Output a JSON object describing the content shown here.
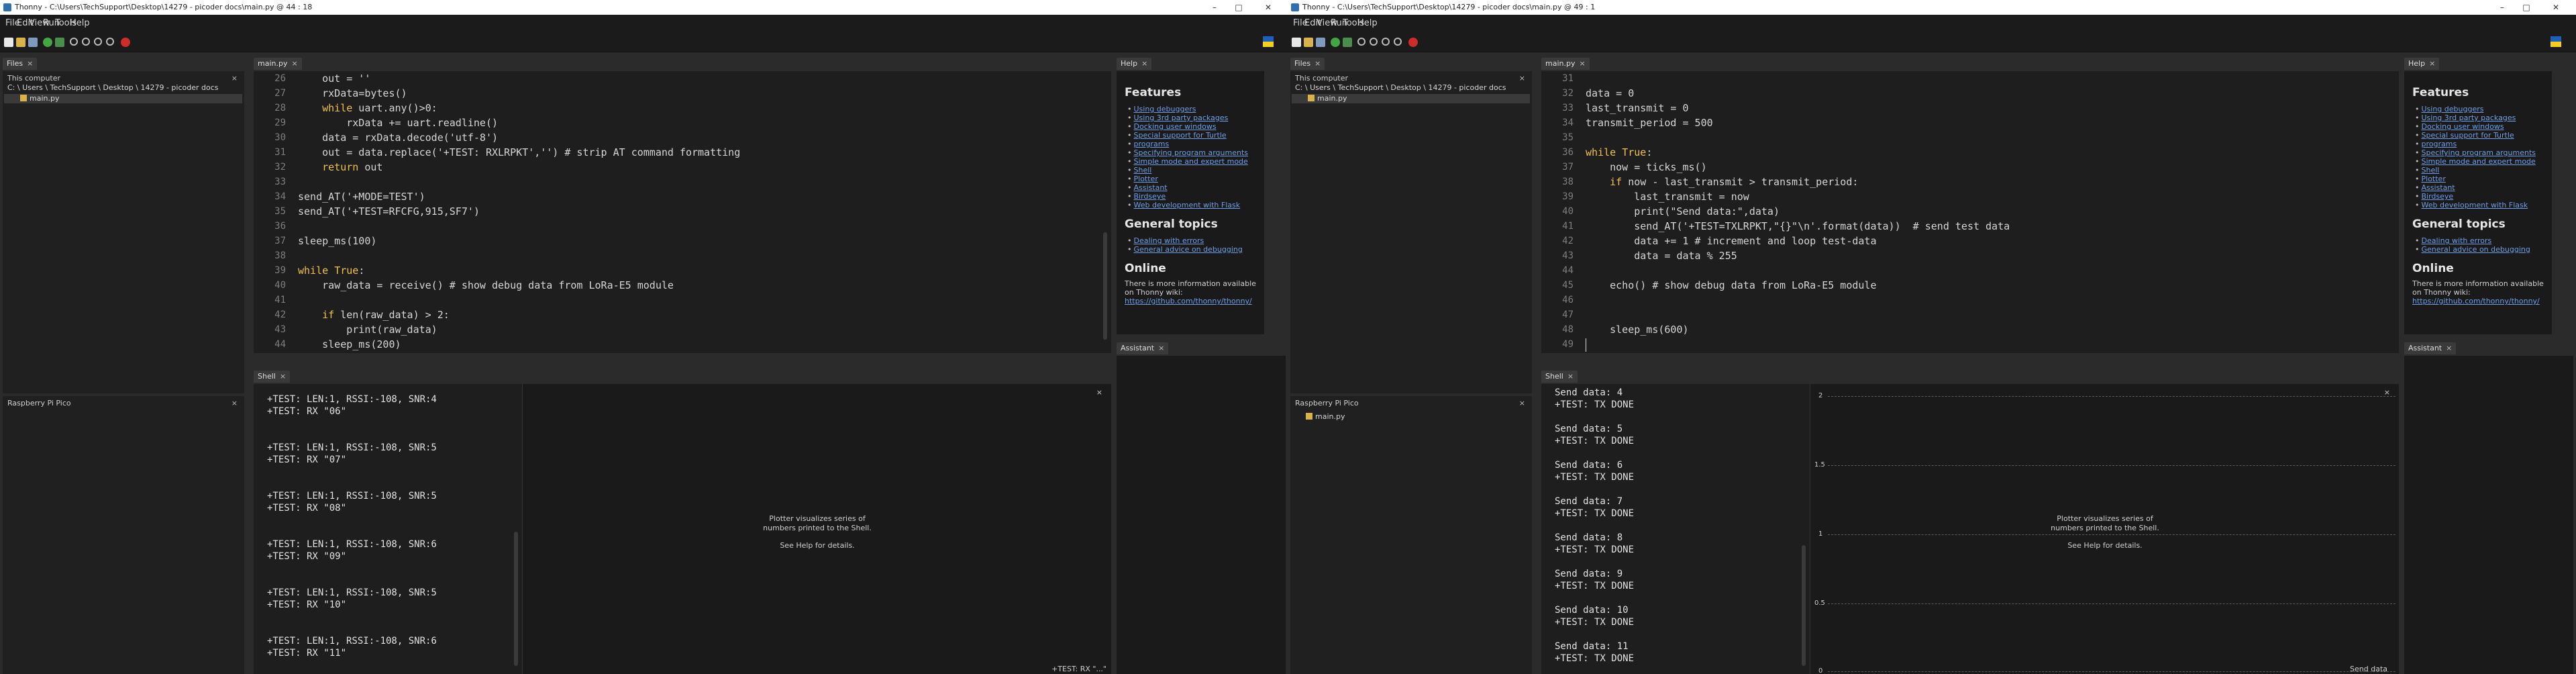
{
  "left": {
    "title": "Thonny  -  C:\\Users\\TechSupport\\Desktop\\14279 - picoder docs\\main.py  @  44 : 18",
    "menu": [
      "File",
      "Edit",
      "View",
      "Run",
      "Tools",
      "Help"
    ],
    "files_tab": "Files",
    "this_computer": "This computer",
    "path": "C: \\ Users \\ TechSupport \\ Desktop \\ 14279 - picoder docs",
    "file_main": "main.py",
    "pico_header": "Raspberry Pi Pico",
    "editor_tab": "main.py",
    "line_numbers": [
      "26",
      "27",
      "28",
      "29",
      "30",
      "31",
      "32",
      "33",
      "34",
      "35",
      "36",
      "37",
      "38",
      "39",
      "40",
      "41",
      "42",
      "43",
      "44"
    ],
    "code": [
      "    out = ''",
      "    rxData=bytes()",
      "    while uart.any()>0:",
      "        rxData += uart.readline()",
      "    data = rxData.decode('utf-8')",
      "    out = data.replace('+TEST: RXLRPKT','') # strip AT command formatting",
      "    return out",
      "",
      "send_AT('+MODE=TEST')",
      "send_AT('+TEST=RFCFG,915,SF7')",
      "",
      "sleep_ms(100)",
      "",
      "while True:",
      "    raw_data = receive() # show debug data from LoRa-E5 module",
      "",
      "    if len(raw_data) > 2:",
      "        print(raw_data)",
      "    sleep_ms(200)"
    ],
    "shell_tab": "Shell",
    "shell": [
      "+TEST: LEN:1, RSSI:-108, SNR:4",
      "+TEST: RX \"06\"",
      "",
      "",
      "+TEST: LEN:1, RSSI:-108, SNR:5",
      "+TEST: RX \"07\"",
      "",
      "",
      "+TEST: LEN:1, RSSI:-108, SNR:5",
      "+TEST: RX \"08\"",
      "",
      "",
      "+TEST: LEN:1, RSSI:-108, SNR:6",
      "+TEST: RX \"09\"",
      "",
      "",
      "+TEST: LEN:1, RSSI:-108, SNR:5",
      "+TEST: RX \"10\"",
      "",
      "",
      "+TEST: LEN:1, RSSI:-108, SNR:6",
      "+TEST: RX \"11\""
    ],
    "plotter_msg1": "Plotter visualizes series of",
    "plotter_msg2": "numbers printed to the Shell.",
    "plotter_msg3": "See Help for details.",
    "plotter_corner": "+TEST: RX \"...\"",
    "help_tab": "Help",
    "assistant_tab": "Assistant"
  },
  "right": {
    "title": "Thonny  -  C:\\Users\\TechSupport\\Desktop\\14279 - picoder docs\\main.py  @  49 : 1",
    "menu": [
      "File",
      "Edit",
      "View",
      "Run",
      "Tools",
      "Help"
    ],
    "files_tab": "Files",
    "this_computer": "This computer",
    "path": "C: \\ Users \\ TechSupport \\ Desktop \\ 14279 - picoder docs",
    "file_main": "main.py",
    "pico_header": "Raspberry Pi Pico",
    "pico_file": "main.py",
    "editor_tab": "main.py",
    "line_numbers": [
      "31",
      "32",
      "33",
      "34",
      "35",
      "36",
      "37",
      "38",
      "39",
      "40",
      "41",
      "42",
      "43",
      "44",
      "45",
      "46",
      "47",
      "48",
      "49"
    ],
    "code": [
      "",
      "data = 0",
      "last_transmit = 0",
      "transmit_period = 500",
      "",
      "while True:",
      "    now = ticks_ms()",
      "    if now - last_transmit > transmit_period:",
      "        last_transmit = now",
      "        print(\"Send data:\",data)",
      "        send_AT('+TEST=TXLRPKT,\"{}\"\\n'.format(data))  # send test data",
      "        data += 1 # increment and loop test-data",
      "        data = data % 255",
      "",
      "    echo() # show debug data from LoRa-E5 module",
      "",
      "",
      "    sleep_ms(600)",
      ""
    ],
    "shell_tab": "Shell",
    "shell": [
      "Send data: 4",
      "+TEST: TX DONE",
      "",
      "Send data: 5",
      "+TEST: TX DONE",
      "",
      "Send data: 6",
      "+TEST: TX DONE",
      "",
      "Send data: 7",
      "+TEST: TX DONE",
      "",
      "Send data: 8",
      "+TEST: TX DONE",
      "",
      "Send data: 9",
      "+TEST: TX DONE",
      "",
      "Send data: 10",
      "+TEST: TX DONE",
      "",
      "Send data: 11",
      "+TEST: TX DONE"
    ],
    "plot_ticks": [
      "2",
      "1.5",
      "1",
      "0.5",
      "0"
    ],
    "plotter_msg1": "Plotter visualizes series of",
    "plotter_msg2": "numbers printed to the Shell.",
    "plotter_msg3": "See Help for details.",
    "plot_legend": "Send data",
    "help_tab": "Help",
    "assistant_tab": "Assistant"
  },
  "help": {
    "features": "Features",
    "feature_links": [
      "Using debuggers",
      "Using 3rd party packages",
      "Docking user windows",
      "Special support for Turtle",
      "programs",
      "Specifying program arguments",
      "Simple mode and expert mode",
      "Shell",
      "Plotter",
      "Assistant",
      "Birdseye",
      "Web development with Flask"
    ],
    "general": "General topics",
    "general_links": [
      "Dealing with errors",
      "General advice on debugging"
    ],
    "online": "Online",
    "online_text1": "There is more information available",
    "online_text2": "on Thonny wiki:",
    "online_link": "https://github.com/thonny/thonny/"
  }
}
